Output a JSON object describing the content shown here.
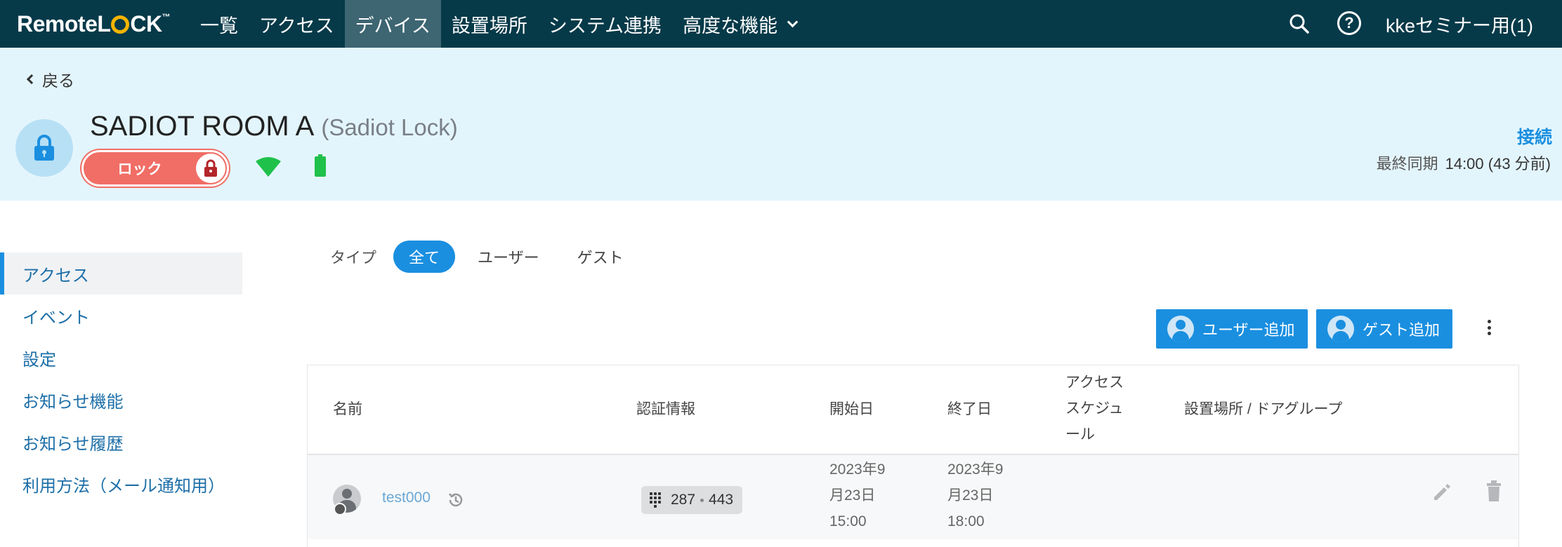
{
  "brand": {
    "logo_text_left": "Remote",
    "logo_text_l": "L",
    "logo_text_right": "CK",
    "logo_tm": "™"
  },
  "nav": {
    "items": [
      {
        "label": "一覧",
        "active": false
      },
      {
        "label": "アクセス",
        "active": false
      },
      {
        "label": "デバイス",
        "active": true
      },
      {
        "label": "設置場所",
        "active": false
      },
      {
        "label": "システム連携",
        "active": false
      },
      {
        "label": "高度な機能",
        "active": false,
        "has_dropdown": true
      }
    ],
    "icons": {
      "search": "search-icon",
      "help": "help-icon",
      "help_glyph": "?"
    },
    "account": "kkeセミナー用(1)"
  },
  "device": {
    "back_label": "戻る",
    "name": "SADIOT ROOM A",
    "model": "(Sadiot Lock)",
    "lock_label": "ロック",
    "wifi": "wifi-icon",
    "battery": "battery-icon",
    "connection_status": "接続",
    "last_sync_label": "最終同期",
    "last_sync_value": "14:00 (43 分前)"
  },
  "sidebar": {
    "items": [
      {
        "label": "アクセス",
        "active": true
      },
      {
        "label": "イベント",
        "active": false
      },
      {
        "label": "設定",
        "active": false
      },
      {
        "label": "お知らせ機能",
        "active": false
      },
      {
        "label": "お知らせ履歴",
        "active": false
      },
      {
        "label": "利用方法（メール通知用）",
        "active": false
      }
    ]
  },
  "filters": {
    "label": "タイプ",
    "options": [
      {
        "label": "全て",
        "active": true
      },
      {
        "label": "ユーザー",
        "active": false
      },
      {
        "label": "ゲスト",
        "active": false
      }
    ]
  },
  "actions": {
    "add_user": "ユーザー追加",
    "add_guest": "ゲスト追加",
    "more": "more-vert-icon"
  },
  "table": {
    "headers": {
      "name": "名前",
      "credentials": "認証情報",
      "start": "開始日",
      "end": "終了日",
      "schedule": [
        "アクセス",
        "スケジュ",
        "ール"
      ],
      "location": "設置場所 / ドアグループ"
    },
    "rows": [
      {
        "name": "test000",
        "code_a": "287",
        "code_b": "443",
        "start": [
          "2023年9",
          "月23日",
          "15:00"
        ],
        "end": [
          "2023年9",
          "月23日",
          "18:00"
        ],
        "schedule": "",
        "location": ""
      }
    ]
  },
  "colors": {
    "nav_bg": "#063a49",
    "nav_active": "#3d6572",
    "header_bg": "#e3f5fc",
    "accent": "#1a8fe0",
    "lock_red": "#f06e66",
    "status_green": "#1fc14b"
  }
}
